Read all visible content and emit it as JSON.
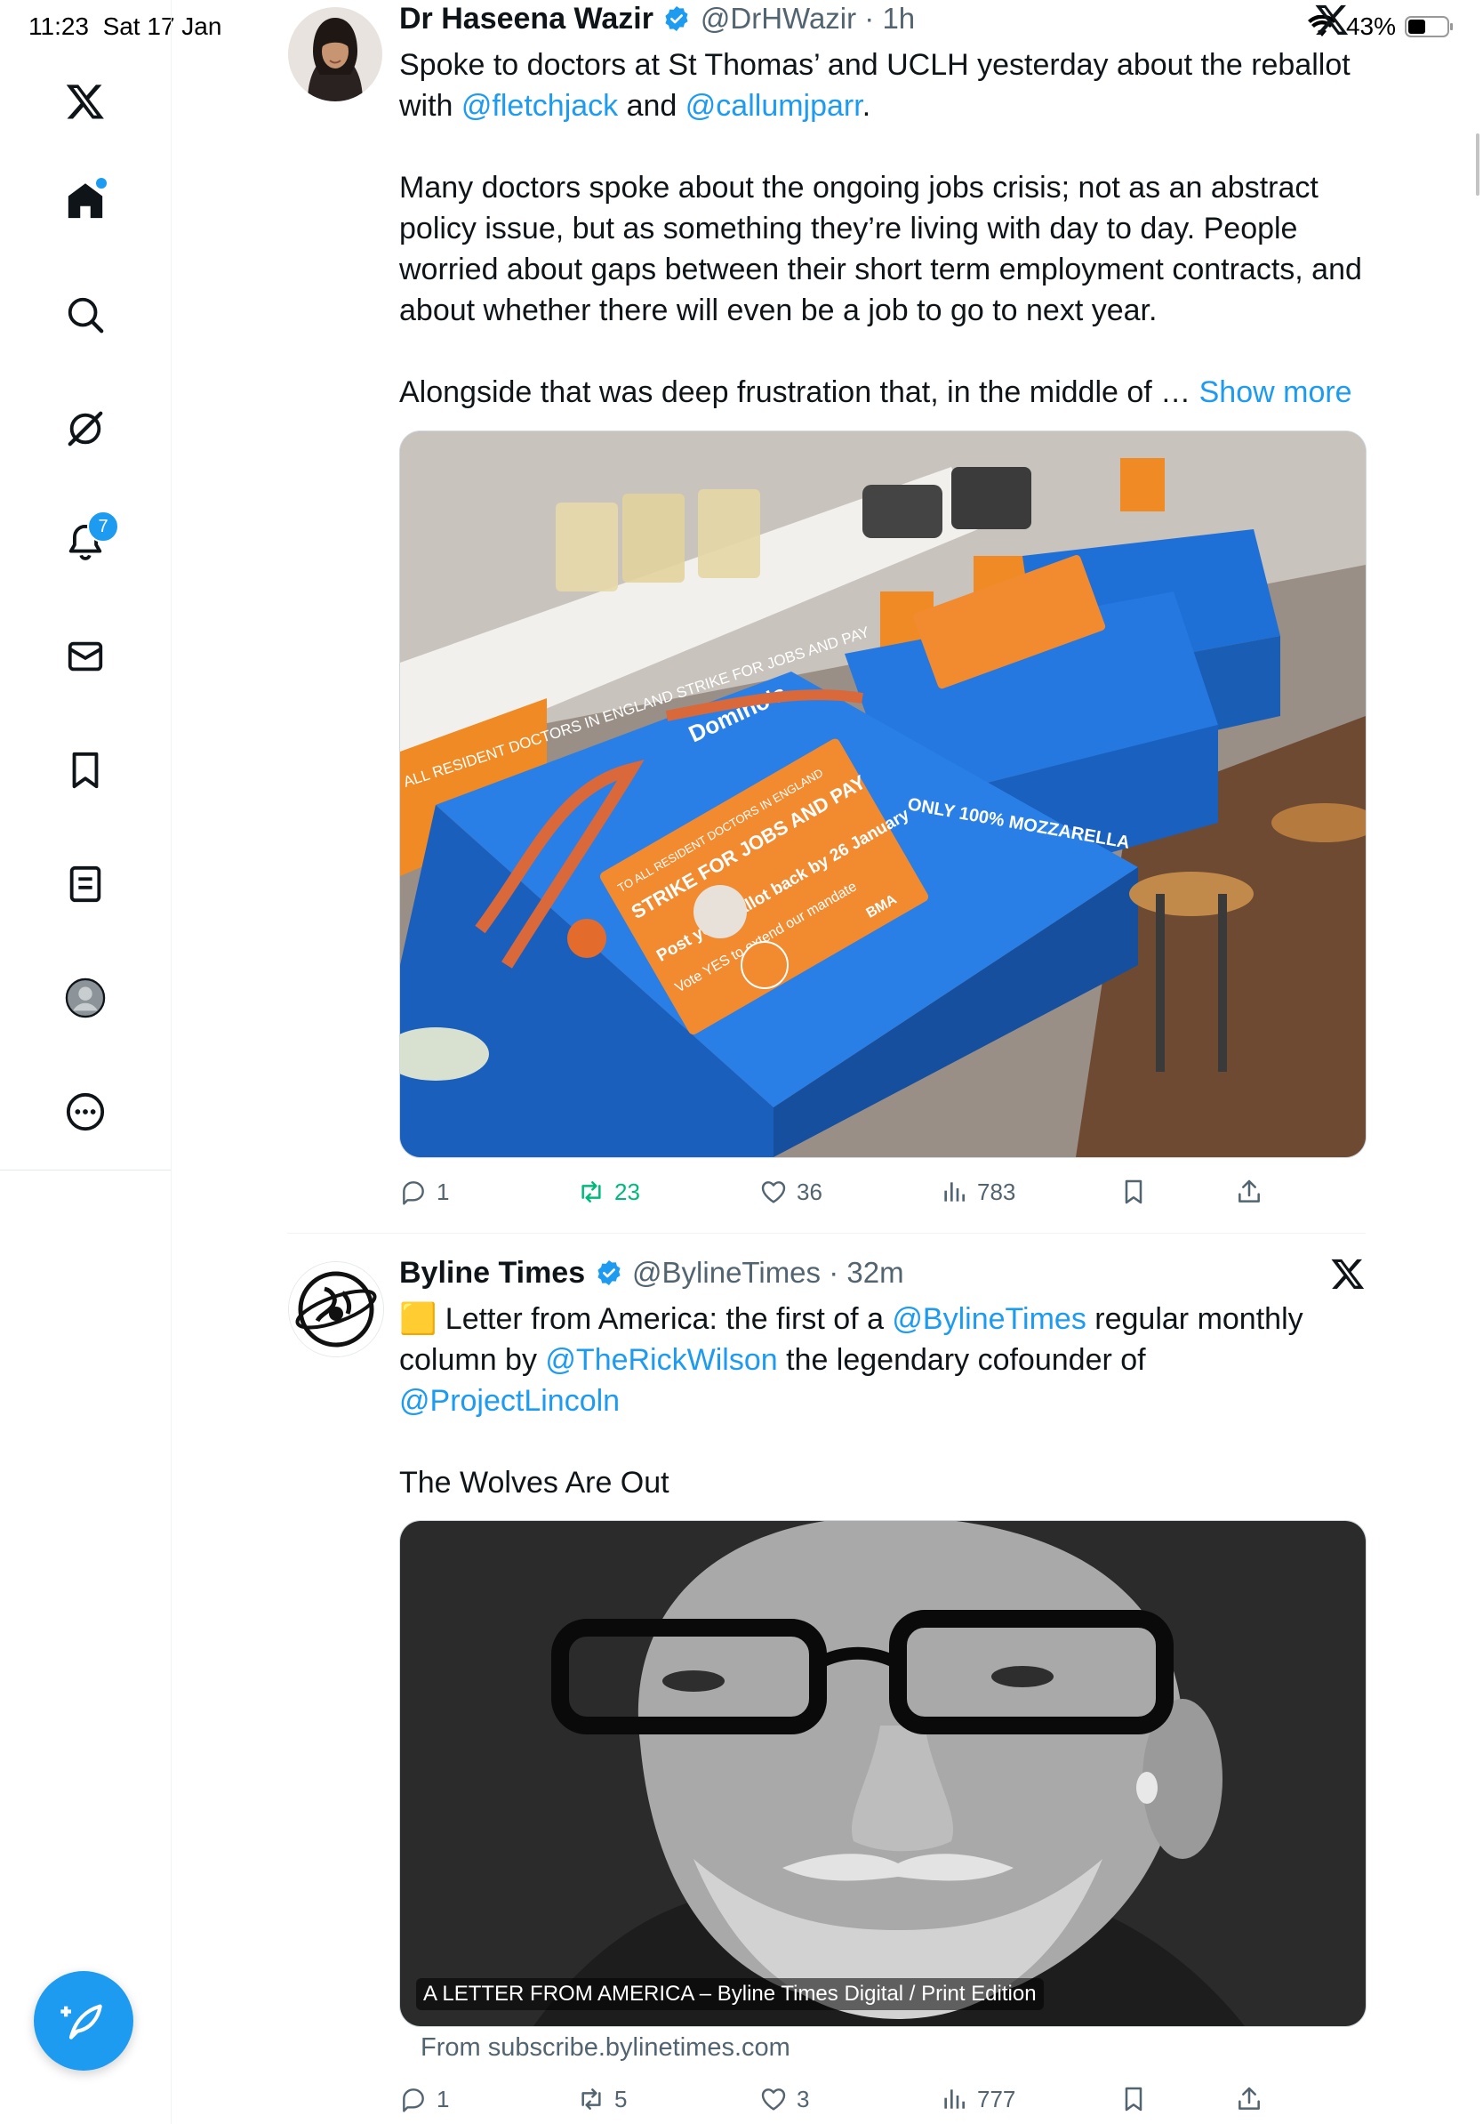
{
  "status_bar": {
    "time": "11:23",
    "date": "Sat 17 Jan",
    "battery": "43%"
  },
  "sidebar": {
    "items": [
      {
        "name": "x-logo-icon"
      },
      {
        "name": "home-icon"
      },
      {
        "name": "search-icon"
      },
      {
        "name": "grok-icon"
      },
      {
        "name": "notifications-icon",
        "badge": "7"
      },
      {
        "name": "messages-icon"
      },
      {
        "name": "bookmarks-icon"
      },
      {
        "name": "lists-icon"
      },
      {
        "name": "profile-icon"
      },
      {
        "name": "more-icon"
      }
    ],
    "compose": "compose-icon"
  },
  "tweets": [
    {
      "display_name": "Dr Haseena Wazir",
      "handle": "@DrHWazir",
      "time": "1h",
      "line1": "Spoke to doctors at St Thomas’ and UCLH yesterday about the reballot",
      "line2_pre": "with ",
      "mention1": "@fletchjack",
      "line2_mid": " and ",
      "mention2": "@callumjparr",
      "line2_post": ".",
      "para2": "Many doctors spoke about the ongoing jobs crisis; not as an abstract policy issue, but as something they’re living with day to day. People worried about gaps between their short term employment contracts, and about whether there will even be a job to go to next year.",
      "para3": "Alongside that was deep frustration that, in the middle of … ",
      "show_more": "Show more",
      "image_text": {
        "leaflet_line1": "TO ALL RESIDENT DOCTORS IN ENGLAND",
        "leaflet_line2": "STRIKE FOR JOBS AND PAY",
        "leaflet_line3": "Post your ballot back by 26 January",
        "leaflet_line4": "Vote YES to extend our mandate",
        "box_brand": "Domino's",
        "box_label": "ONLY 100% MOZZARELLA",
        "poster": "ALL RESIDENT DOCTORS IN ENGLAND STRIKE FOR JOBS AND PAY",
        "bma": "BMA"
      },
      "replies": "1",
      "reposts": "23",
      "likes": "36",
      "views": "783"
    },
    {
      "display_name": "Byline Times",
      "handle": "@BylineTimes",
      "time": "32m",
      "emoji": "🟨",
      "line1_pre": " Letter from America: the first of a ",
      "mention1": "@BylineTimes",
      "line1_post": " regular monthly",
      "line2_pre": "column by ",
      "mention2": "@TheRickWilson",
      "line2_post": "  the legendary cofounder of",
      "mention3": "@ProjectLincoln",
      "para2": "The Wolves Are Out",
      "card_caption": "A LETTER FROM AMERICA – Byline Times Digital / Print Edition",
      "card_source": "From subscribe.bylinetimes.com",
      "replies": "1",
      "reposts": "5",
      "likes": "3",
      "views": "777"
    }
  ],
  "colors": {
    "accent": "#1d9bf0",
    "text": "#0f1419",
    "muted": "#536471",
    "repost_green": "#00ba7c"
  }
}
